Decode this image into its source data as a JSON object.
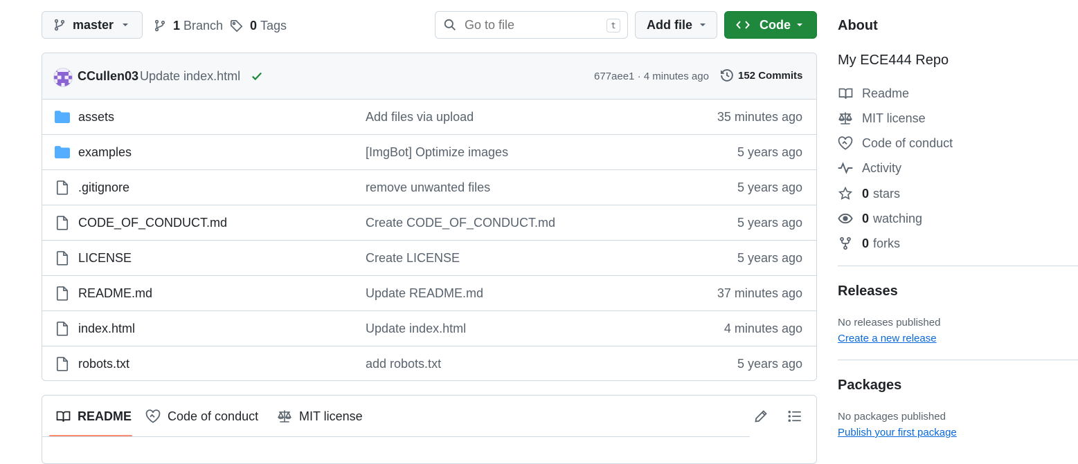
{
  "toolbar": {
    "branch_button": "master",
    "branches_count": "1",
    "branches_label": "Branch",
    "tags_count": "0",
    "tags_label": "Tags",
    "search_placeholder": "Go to file",
    "search_shortcut": "t",
    "add_file_label": "Add file",
    "code_label": "Code"
  },
  "commit": {
    "author": "CCullen03",
    "message": "Update index.html",
    "hash_time": "677aee1 · 4 minutes ago",
    "commits_count": "152 Commits"
  },
  "files": [
    {
      "name": "assets",
      "type": "folder",
      "message": "Add files via upload",
      "age": "35 minutes ago"
    },
    {
      "name": "examples",
      "type": "folder",
      "message": "[ImgBot] Optimize images",
      "age": "5 years ago"
    },
    {
      "name": ".gitignore",
      "type": "file",
      "message": "remove unwanted files",
      "age": "5 years ago"
    },
    {
      "name": "CODE_OF_CONDUCT.md",
      "type": "file",
      "message": "Create CODE_OF_CONDUCT.md",
      "age": "5 years ago"
    },
    {
      "name": "LICENSE",
      "type": "file",
      "message": "Create LICENSE",
      "age": "5 years ago"
    },
    {
      "name": "README.md",
      "type": "file",
      "message": "Update README.md",
      "age": "37 minutes ago"
    },
    {
      "name": "index.html",
      "type": "file",
      "message": "Update index.html",
      "age": "4 minutes ago"
    },
    {
      "name": "robots.txt",
      "type": "file",
      "message": "add robots.txt",
      "age": "5 years ago"
    }
  ],
  "readme_tabs": {
    "readme": "README",
    "conduct": "Code of conduct",
    "license": "MIT license"
  },
  "about": {
    "title": "About",
    "description": "My ECE444 Repo",
    "readme": "Readme",
    "license": "MIT license",
    "conduct": "Code of conduct",
    "activity": "Activity",
    "stars_count": "0",
    "stars_label": "stars",
    "watching_count": "0",
    "watching_label": "watching",
    "forks_count": "0",
    "forks_label": "forks"
  },
  "releases": {
    "title": "Releases",
    "empty": "No releases published",
    "link": "Create a new release"
  },
  "packages": {
    "title": "Packages",
    "empty": "No packages published",
    "link": "Publish your first package"
  },
  "colors": {
    "accent_green": "#1f883d",
    "link_blue": "#0969da",
    "folder_blue": "#54aeff",
    "tab_underline": "#fd8c73"
  }
}
